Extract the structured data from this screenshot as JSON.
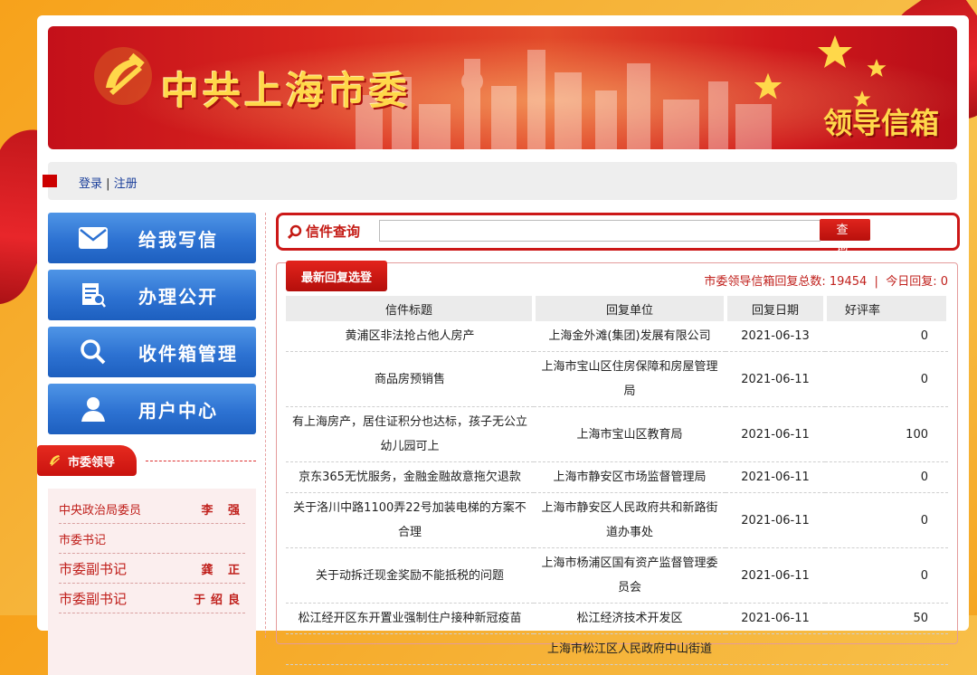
{
  "banner": {
    "title": "中共上海市委",
    "subtitle": "领导信箱"
  },
  "auth": {
    "login": "登录",
    "separator": "|",
    "register": "注册"
  },
  "nav": [
    {
      "label": "给我写信",
      "icon": "envelope-icon"
    },
    {
      "label": "办理公开",
      "icon": "document-search-icon"
    },
    {
      "label": "收件箱管理",
      "icon": "magnifier-icon"
    },
    {
      "label": "用户中心",
      "icon": "user-icon"
    }
  ],
  "leaders_section": {
    "title": "市委领导",
    "rows": [
      {
        "title": "中央政治局委员",
        "name": "李 强"
      },
      {
        "title": "市委书记",
        "name": ""
      },
      {
        "title": "市委副书记",
        "name": "龚 正"
      },
      {
        "title": "市委副书记",
        "name": "于绍良"
      }
    ]
  },
  "search": {
    "label": "信件查询",
    "placeholder": "",
    "button": "查 询"
  },
  "replies": {
    "tab": "最新回复选登",
    "total_label": "市委领导信箱回复总数:",
    "total": "19454",
    "sep": "|",
    "today_label": "今日回复:",
    "today": "0",
    "columns": [
      "信件标题",
      "回复单位",
      "回复日期",
      "好评率"
    ],
    "rows": [
      {
        "title": "黄浦区非法抢占他人房产",
        "unit": "上海金外滩(集团)发展有限公司",
        "date": "2021-06-13",
        "rate": "0"
      },
      {
        "title": "商品房预销售",
        "unit": "上海市宝山区住房保障和房屋管理局",
        "date": "2021-06-11",
        "rate": "0"
      },
      {
        "title": "有上海房产，居住证积分也达标，孩子无公立幼儿园可上",
        "unit": "上海市宝山区教育局",
        "date": "2021-06-11",
        "rate": "100"
      },
      {
        "title": "京东365无忧服务，金融金融故意拖欠退款",
        "unit": "上海市静安区市场监督管理局",
        "date": "2021-06-11",
        "rate": "0"
      },
      {
        "title": "关于洛川中路1100弄22号加装电梯的方案不合理",
        "unit": "上海市静安区人民政府共和新路街道办事处",
        "date": "2021-06-11",
        "rate": "0"
      },
      {
        "title": "关于动拆迁现金奖励不能抵税的问题",
        "unit": "上海市杨浦区国有资产监督管理委员会",
        "date": "2021-06-11",
        "rate": "0"
      },
      {
        "title": "松江经开区东开置业强制住户接种新冠疫苗",
        "unit": "松江经济技术开发区",
        "date": "2021-06-11",
        "rate": "50"
      },
      {
        "title": "",
        "unit": "上海市松江区人民政府中山街道",
        "date": "",
        "rate": ""
      }
    ]
  },
  "colors": {
    "brand_red": "#cc1818",
    "nav_blue": "#2d72d2",
    "banner_gold": "#ffd84a"
  }
}
